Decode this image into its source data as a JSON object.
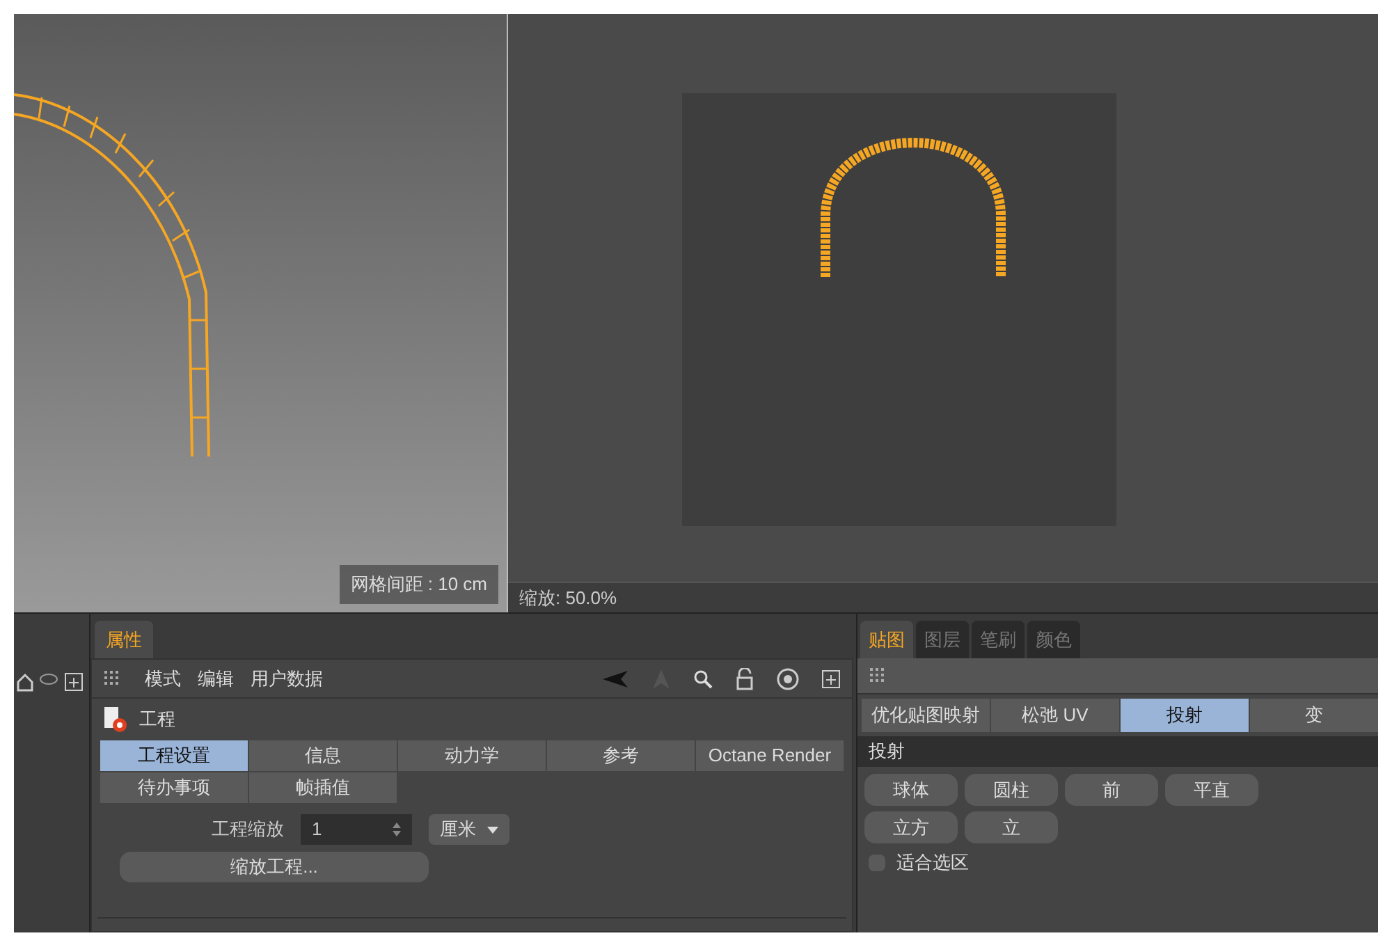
{
  "viewports": {
    "left": {
      "grid_label": "网格间距 : 10 cm"
    },
    "right": {
      "zoom_label": "缩放: 50.0%"
    }
  },
  "attributes": {
    "panel_tab": "属性",
    "menu": [
      "模式",
      "编辑",
      "用户数据"
    ],
    "object": "工程",
    "tabs": [
      {
        "label": "工程设置",
        "selected": true
      },
      {
        "label": "信息",
        "selected": false
      },
      {
        "label": "动力学",
        "selected": false
      },
      {
        "label": "参考",
        "selected": false
      },
      {
        "label": "Octane Render",
        "selected": false
      },
      {
        "label": "待办事项",
        "selected": false
      },
      {
        "label": "帧插值",
        "selected": false
      }
    ],
    "scale_label": "工程缩放",
    "scale_value": "1",
    "unit": "厘米",
    "scale_button": "缩放工程..."
  },
  "uv_panel": {
    "tabs": [
      {
        "label": "贴图",
        "selected": true
      },
      {
        "label": "图层",
        "selected": false
      },
      {
        "label": "笔刷",
        "selected": false
      },
      {
        "label": "颜色",
        "selected": false
      }
    ],
    "subtabs": [
      {
        "label": "优化贴图映射",
        "selected": false
      },
      {
        "label": "松弛 UV",
        "selected": false
      },
      {
        "label": "投射",
        "selected": true
      },
      {
        "label": "变",
        "selected": false
      }
    ],
    "section": "投射",
    "buttons": [
      [
        "球体",
        "圆柱",
        "前",
        "平直"
      ],
      [
        "立方",
        "立"
      ]
    ],
    "fit_selection": {
      "label": "适合选区",
      "checked": false
    }
  }
}
